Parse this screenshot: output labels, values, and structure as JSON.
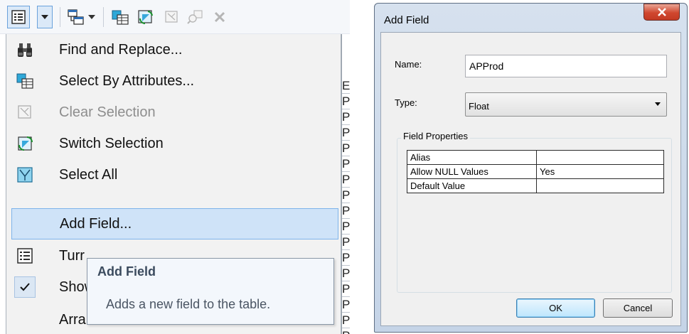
{
  "menu": {
    "items": [
      {
        "label": "Find and Replace...",
        "icon": "binoculars-icon",
        "enabled": true
      },
      {
        "label": "Select By Attributes...",
        "icon": "select-by-attributes-icon",
        "enabled": true
      },
      {
        "label": "Clear Selection",
        "icon": "clear-selection-icon",
        "enabled": false
      },
      {
        "label": "Switch Selection",
        "icon": "switch-selection-icon",
        "enabled": true
      },
      {
        "label": "Select All",
        "icon": "select-all-icon",
        "enabled": true
      },
      {
        "label": "Add Field...",
        "icon": "",
        "enabled": true,
        "highlighted": true
      },
      {
        "label": "Turn All Fields On",
        "icon": "field-list-icon",
        "enabled": true
      },
      {
        "label": "Show Field Aliases",
        "icon": "checkmark-icon",
        "enabled": true,
        "checked": true
      },
      {
        "label": "Arrange Tables",
        "icon": "",
        "enabled": true
      }
    ],
    "visible_labels": [
      "Turr",
      "Show",
      "Arra"
    ]
  },
  "tooltip": {
    "title": "Add Field",
    "description": "Adds a new field to the table."
  },
  "grid_edge": [
    "E",
    "P",
    "P",
    "P",
    "P",
    "P",
    "P",
    "P",
    "P",
    "P",
    "P",
    "P",
    "P",
    "P",
    "P",
    "P",
    "P"
  ],
  "dialog": {
    "title": "Add Field",
    "name_label": "Name:",
    "name_value": "APProd",
    "type_label": "Type:",
    "type_value": "Float",
    "group_title": "Field Properties",
    "properties": [
      {
        "name": "Alias",
        "value": ""
      },
      {
        "name": "Allow NULL Values",
        "value": "Yes"
      },
      {
        "name": "Default Value",
        "value": ""
      }
    ],
    "ok_label": "OK",
    "cancel_label": "Cancel"
  },
  "colors": {
    "highlight_bg": "#cfe3f8",
    "highlight_border": "#7eb4ea",
    "close_button": "#c9452e",
    "accent_blue": "#1f6fc0"
  }
}
